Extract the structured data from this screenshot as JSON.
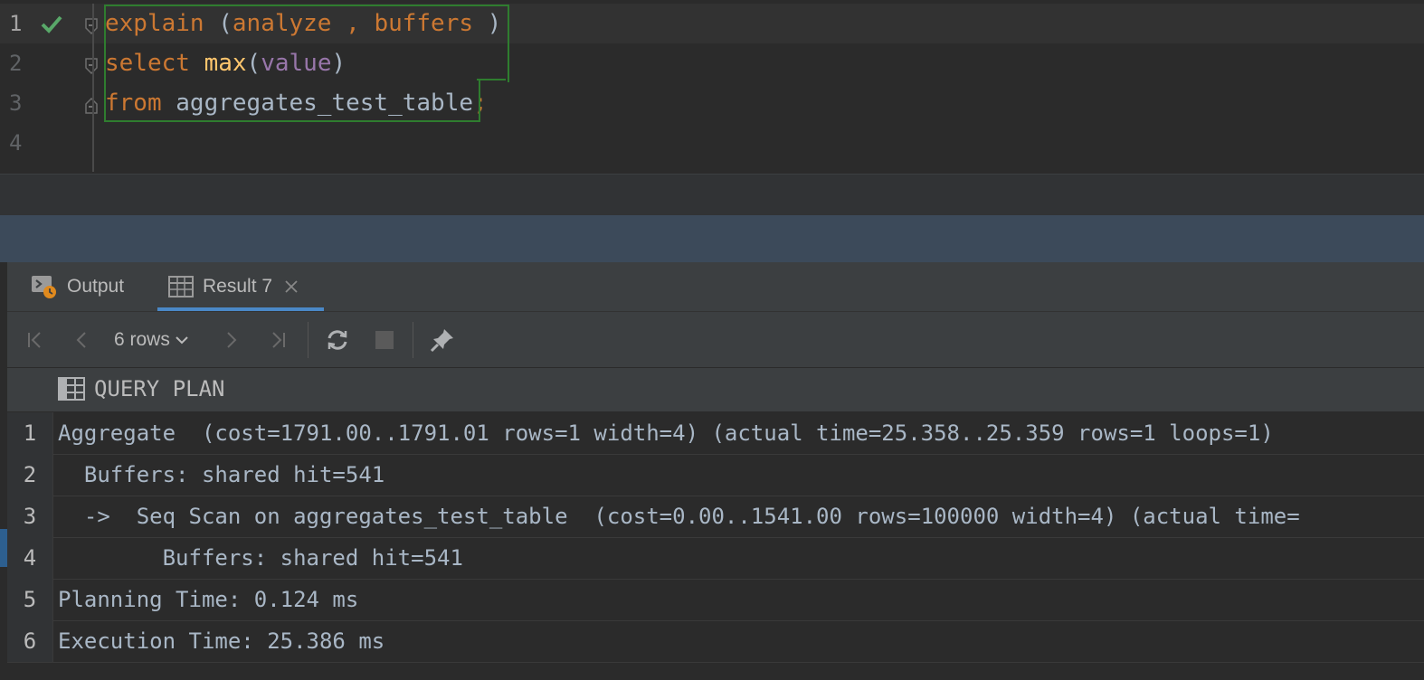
{
  "editor": {
    "lines": [
      {
        "num": "1",
        "tokens": [
          {
            "t": "explain",
            "c": "kw"
          },
          {
            "t": " (",
            "c": "plain"
          },
          {
            "t": "analyze",
            "c": "kw"
          },
          {
            "t": " , ",
            "c": "kw"
          },
          {
            "t": "buffers",
            "c": "kw"
          },
          {
            "t": " )",
            "c": "plain"
          }
        ]
      },
      {
        "num": "2",
        "tokens": [
          {
            "t": "select",
            "c": "kw"
          },
          {
            "t": " ",
            "c": "plain"
          },
          {
            "t": "max",
            "c": "fn"
          },
          {
            "t": "(",
            "c": "plain"
          },
          {
            "t": "value",
            "c": "id"
          },
          {
            "t": ")",
            "c": "plain"
          }
        ]
      },
      {
        "num": "3",
        "tokens": [
          {
            "t": "from",
            "c": "kw"
          },
          {
            "t": " aggregates_test_table",
            "c": "plain"
          },
          {
            "t": ";",
            "c": "kw"
          }
        ]
      },
      {
        "num": "4",
        "tokens": []
      }
    ]
  },
  "tabs": {
    "output_label": "Output",
    "result_label": "Result 7"
  },
  "toolbar": {
    "rows_label": "6 rows"
  },
  "grid": {
    "column_header": "QUERY PLAN",
    "rows": [
      {
        "num": "1",
        "text": "Aggregate  (cost=1791.00..1791.01 rows=1 width=4) (actual time=25.358..25.359 rows=1 loops=1)"
      },
      {
        "num": "2",
        "text": "  Buffers: shared hit=541"
      },
      {
        "num": "3",
        "text": "  ->  Seq Scan on aggregates_test_table  (cost=0.00..1541.00 rows=100000 width=4) (actual time="
      },
      {
        "num": "4",
        "text": "        Buffers: shared hit=541"
      },
      {
        "num": "5",
        "text": "Planning Time: 0.124 ms"
      },
      {
        "num": "6",
        "text": "Execution Time: 25.386 ms"
      }
    ]
  },
  "colors": {
    "keyword": "#cc7832",
    "function": "#ffc66d",
    "identifier": "#9876aa",
    "plain": "#a9b7c6",
    "success": "#59a869",
    "tab_underline": "#4a88c7"
  },
  "icons": [
    "check-icon",
    "fold-icon",
    "output-icon",
    "table-icon",
    "close-icon",
    "first-page-icon",
    "prev-page-icon",
    "chevron-down-icon",
    "next-page-icon",
    "last-page-icon",
    "refresh-icon",
    "stop-icon",
    "pin-icon",
    "column-table-icon"
  ]
}
